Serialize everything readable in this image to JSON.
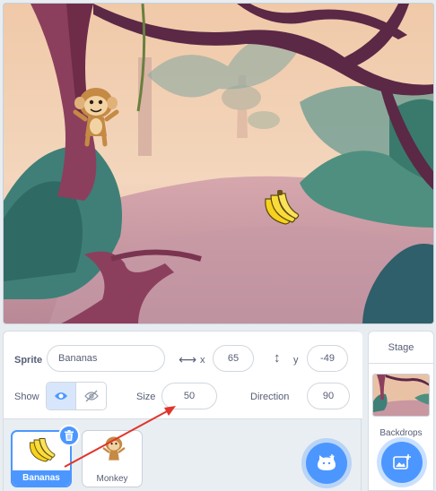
{
  "stage": {
    "sprites": [
      {
        "name": "Monkey",
        "icon": "monkey-sprite"
      },
      {
        "name": "Bananas",
        "icon": "banana-sprite"
      }
    ]
  },
  "sprite_info": {
    "sprite_label": "Sprite",
    "sprite_name": "Bananas",
    "x_label": "x",
    "x_value": "65",
    "y_label": "y",
    "y_value": "-49",
    "show_label": "Show",
    "size_label": "Size",
    "size_value": "50",
    "direction_label": "Direction",
    "direction_value": "90"
  },
  "sprite_tray": {
    "items": [
      {
        "label": "Bananas",
        "selected": true
      },
      {
        "label": "Monkey",
        "selected": false
      }
    ]
  },
  "stage_panel": {
    "title": "Stage",
    "backdrops_label": "Backdrops"
  },
  "colors": {
    "accent": "#4c97ff",
    "annotation_arrow": "#e0352b"
  }
}
